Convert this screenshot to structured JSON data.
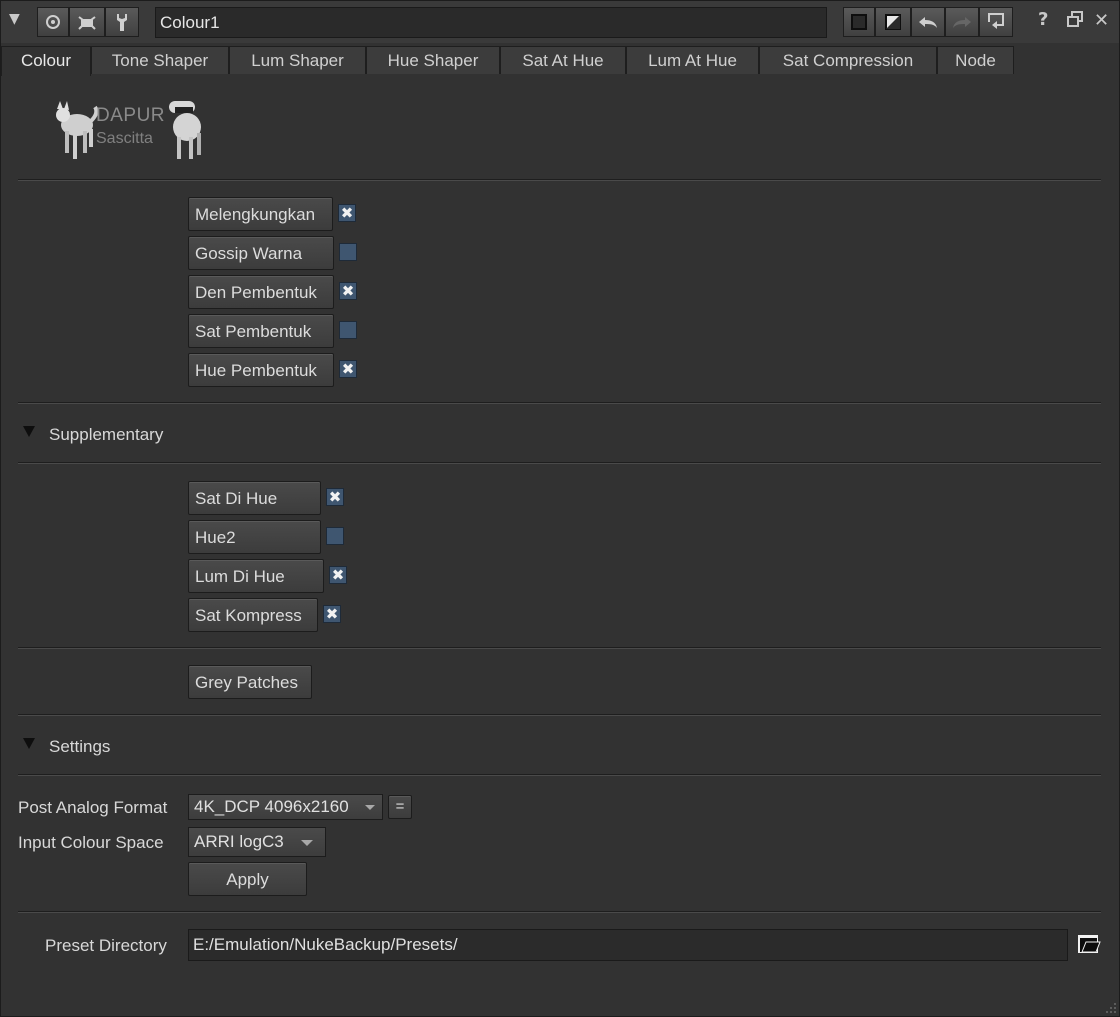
{
  "titlebar": {
    "node_name": "Colour1",
    "icons": [
      "collapse-triangle-icon",
      "view-icon",
      "bug-icon",
      "wrench-icon",
      "color-swatch-icon",
      "color-picker-icon",
      "undo-icon",
      "redo-icon",
      "revert-icon",
      "help-icon",
      "float-icon",
      "close-icon"
    ],
    "help_glyph": "?",
    "close_glyph": "✕"
  },
  "tabs": [
    {
      "label": "Colour",
      "active": true
    },
    {
      "label": "Tone Shaper"
    },
    {
      "label": "Lum Shaper"
    },
    {
      "label": "Hue Shaper"
    },
    {
      "label": "Sat At Hue"
    },
    {
      "label": "Lum At Hue"
    },
    {
      "label": "Sat Compression"
    },
    {
      "label": "Node"
    }
  ],
  "logo": {
    "line1": "DAPUR",
    "line2": "Sascitta"
  },
  "main_toggles": [
    {
      "label": "Melengkungkan",
      "checked": true
    },
    {
      "label": "Gossip Warna",
      "checked": false
    },
    {
      "label": "Den Pembentuk",
      "checked": true
    },
    {
      "label": "Sat Pembentuk",
      "checked": false
    },
    {
      "label": "Hue Pembentuk",
      "checked": true
    }
  ],
  "supplementary": {
    "title": "Supplementary",
    "toggles": [
      {
        "label": "Sat Di Hue",
        "checked": true
      },
      {
        "label": "Hue2",
        "checked": false
      },
      {
        "label": "Lum Di Hue",
        "checked": true
      },
      {
        "label": "Sat Kompress",
        "checked": true
      }
    ],
    "grey_patches": "Grey Patches"
  },
  "settings": {
    "title": "Settings",
    "post_analog_format_label": "Post Analog Format",
    "post_analog_format_value": "4K_DCP 4096x2160",
    "format_eq_button": "=",
    "input_colour_space_label": "Input Colour Space",
    "input_colour_space_value": "ARRI logC3",
    "apply_label": "Apply",
    "preset_directory_label": "Preset Directory",
    "preset_directory_value": "E:/Emulation/NukeBackup/Presets/"
  },
  "colors": {
    "background": "#323232",
    "checkbox": "#3f5670",
    "button": "#444444"
  }
}
